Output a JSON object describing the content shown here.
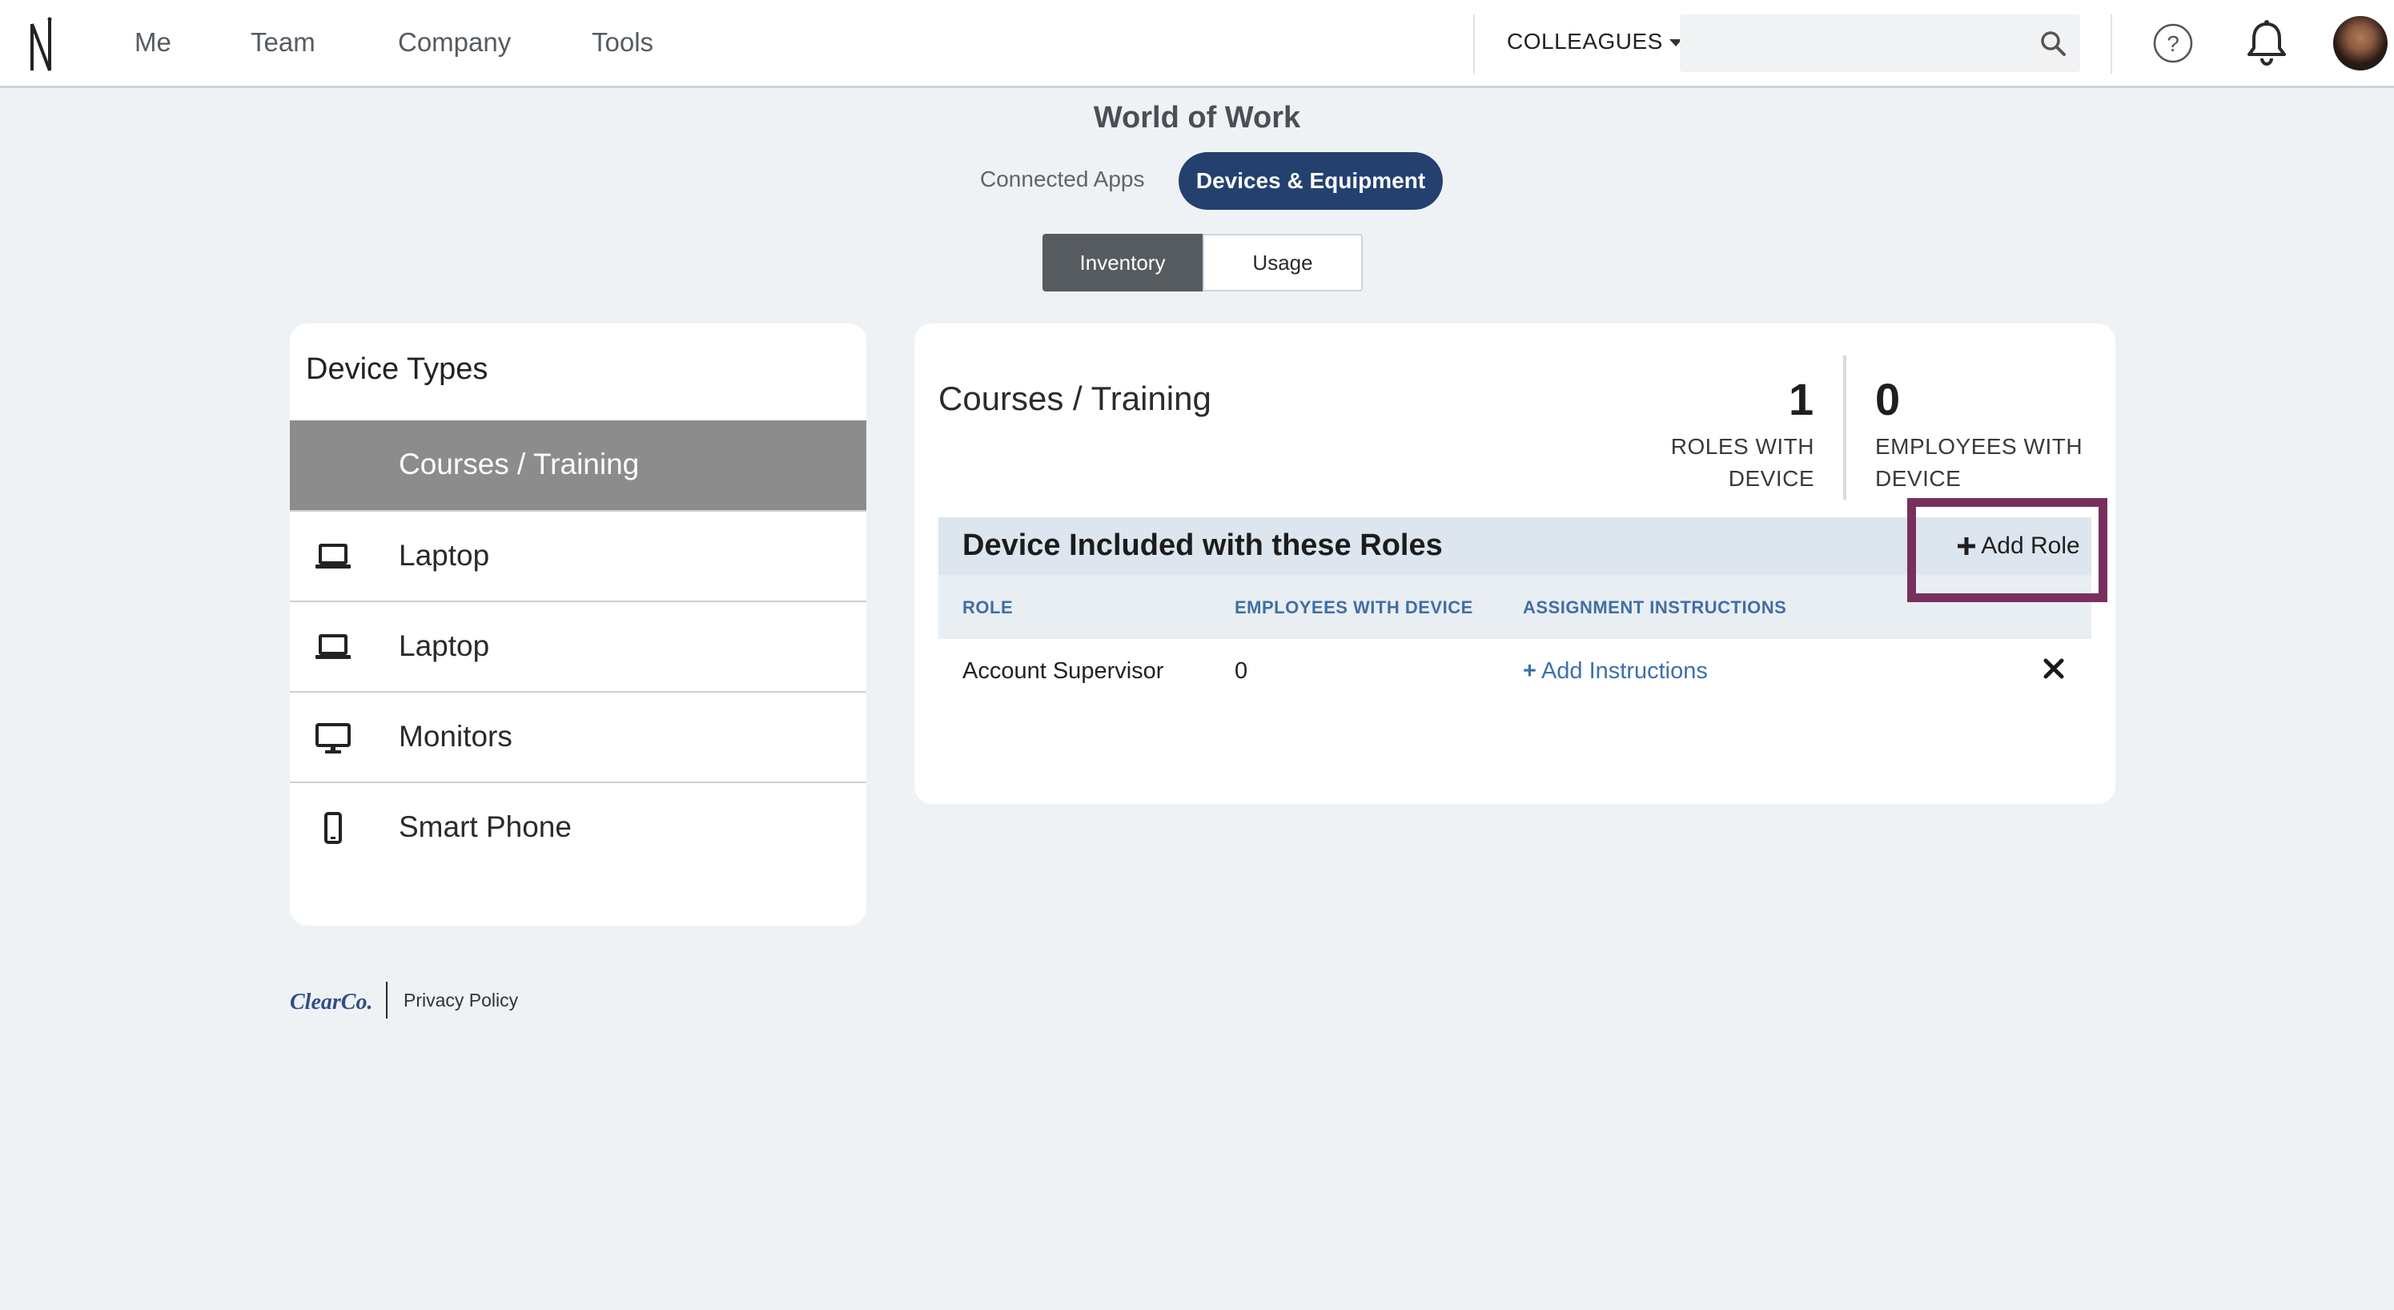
{
  "nav": {
    "items": [
      "Me",
      "Team",
      "Company",
      "Tools"
    ],
    "colleagues_label": "COLLEAGUES",
    "search_placeholder": ""
  },
  "page": {
    "title": "World of Work",
    "tabs": [
      {
        "label": "Connected Apps",
        "active": false
      },
      {
        "label": "Devices & Equipment",
        "active": true
      }
    ],
    "segments": [
      {
        "label": "Inventory",
        "active": true
      },
      {
        "label": "Usage",
        "active": false
      }
    ]
  },
  "device_types": {
    "title": "Device Types",
    "items": [
      {
        "label": "Courses / Training",
        "icon": "none",
        "selected": true
      },
      {
        "label": "Laptop",
        "icon": "laptop-icon",
        "selected": false
      },
      {
        "label": "Laptop",
        "icon": "laptop-icon",
        "selected": false
      },
      {
        "label": "Monitors",
        "icon": "monitor-icon",
        "selected": false
      },
      {
        "label": "Smart Phone",
        "icon": "smartphone-icon",
        "selected": false
      }
    ]
  },
  "detail": {
    "title": "Courses / Training",
    "stats": {
      "roles_count": "1",
      "roles_label_1": "ROLES WITH",
      "roles_label_2": "DEVICE",
      "employees_count": "0",
      "employees_label_1": "EMPLOYEES WITH",
      "employees_label_2": "DEVICE"
    },
    "roles_section_title": "Device Included with these Roles",
    "add_role_label": "Add Role",
    "columns": [
      "ROLE",
      "EMPLOYEES WITH DEVICE",
      "ASSIGNMENT INSTRUCTIONS"
    ],
    "rows": [
      {
        "role": "Account Supervisor",
        "employees": "0",
        "instructions_action": "Add Instructions"
      }
    ]
  },
  "footer": {
    "brand": "ClearCo.",
    "privacy_label": "Privacy Policy"
  },
  "colors": {
    "primary_navy": "#23406f",
    "highlight": "#79305f",
    "link_blue": "#3e6fb0",
    "selected_gray": "#8c8c8c",
    "page_bg": "#eff2f5"
  }
}
